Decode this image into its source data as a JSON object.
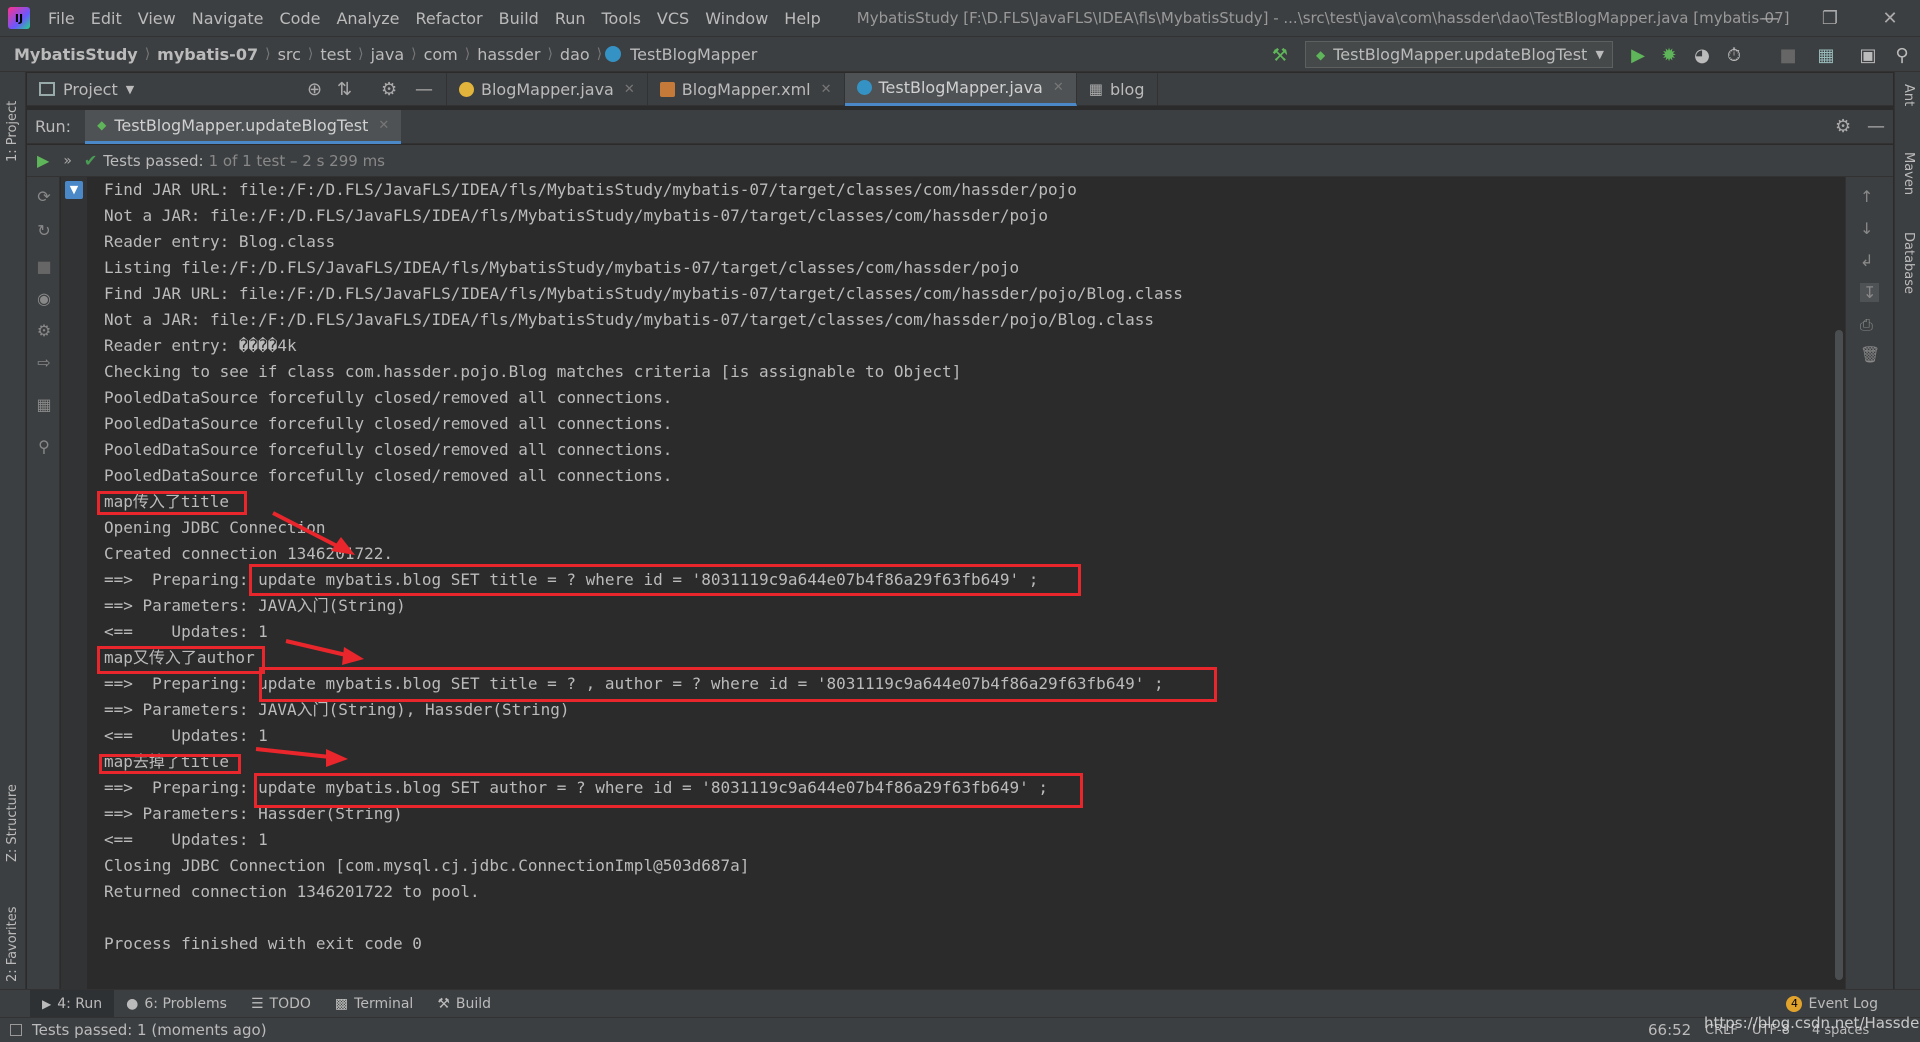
{
  "menubar": {
    "logo_text": "IJ",
    "items": [
      "File",
      "Edit",
      "View",
      "Navigate",
      "Code",
      "Analyze",
      "Refactor",
      "Build",
      "Run",
      "Tools",
      "VCS",
      "Window",
      "Help"
    ],
    "window_title": "MybatisStudy [F:\\D.FLS\\JavaFLS\\IDEA\\fls\\MybatisStudy] - ...\\src\\test\\java\\com\\hassder\\dao\\TestBlogMapper.java [mybatis-07]"
  },
  "breadcrumb": [
    "MybatisStudy",
    "mybatis-07",
    "src",
    "test",
    "java",
    "com",
    "hassder",
    "dao",
    "TestBlogMapper"
  ],
  "run_config": "TestBlogMapper.updateBlogTest",
  "project_pane": {
    "label": "Project"
  },
  "editor_tabs": [
    {
      "label": "BlogMapper.java",
      "color": "#e2b43c"
    },
    {
      "label": "BlogMapper.xml",
      "color": "#c57a3a"
    },
    {
      "label": "TestBlogMapper.java",
      "color": "#3592c4"
    },
    {
      "label": "blog",
      "color": "#999999"
    }
  ],
  "run_panel": {
    "label": "Run:",
    "tab_label": "TestBlogMapper.updateBlogTest",
    "tests_passed": "Tests passed:",
    "tests_count": "1 of 1 test – 2 s 299 ms"
  },
  "console_lines": [
    "Find JAR URL: file:/F:/D.FLS/JavaFLS/IDEA/fls/MybatisStudy/mybatis-07/target/classes/com/hassder/pojo",
    "Not a JAR: file:/F:/D.FLS/JavaFLS/IDEA/fls/MybatisStudy/mybatis-07/target/classes/com/hassder/pojo",
    "Reader entry: Blog.class",
    "Listing file:/F:/D.FLS/JavaFLS/IDEA/fls/MybatisStudy/mybatis-07/target/classes/com/hassder/pojo",
    "Find JAR URL: file:/F:/D.FLS/JavaFLS/IDEA/fls/MybatisStudy/mybatis-07/target/classes/com/hassder/pojo/Blog.class",
    "Not a JAR: file:/F:/D.FLS/JavaFLS/IDEA/fls/MybatisStudy/mybatis-07/target/classes/com/hassder/pojo/Blog.class",
    "Reader entry: ����4k",
    "Checking to see if class com.hassder.pojo.Blog matches criteria [is assignable to Object]",
    "PooledDataSource forcefully closed/removed all connections.",
    "PooledDataSource forcefully closed/removed all connections.",
    "PooledDataSource forcefully closed/removed all connections.",
    "PooledDataSource forcefully closed/removed all connections.",
    "map传入了title",
    "Opening JDBC Connection",
    "Created connection 1346201722.",
    "==>  Preparing: update mybatis.blog SET title = ? where id = '8031119c9a644e07b4f86a29f63fb649' ;",
    "==> Parameters: JAVA入门(String)",
    "<==    Updates: 1",
    "map又传入了author",
    "==>  Preparing: update mybatis.blog SET title = ? , author = ? where id = '8031119c9a644e07b4f86a29f63fb649' ;",
    "==> Parameters: JAVA入门(String), Hassder(String)",
    "<==    Updates: 1",
    "map去掉了title",
    "==>  Preparing: update mybatis.blog SET author = ? where id = '8031119c9a644e07b4f86a29f63fb649' ;",
    "==> Parameters: Hassder(String)",
    "<==    Updates: 1",
    "Closing JDBC Connection [com.mysql.cj.jdbc.ConnectionImpl@503d687a]",
    "Returned connection 1346201722 to pool.",
    "",
    "Process finished with exit code 0"
  ],
  "left_strip": {
    "project": "1: Project",
    "structure": "Z: Structure",
    "favorites": "2: Favorites"
  },
  "right_strip": {
    "ant": "Ant",
    "maven": "Maven",
    "database": "Database"
  },
  "bottom_tools": [
    {
      "label": "4: Run"
    },
    {
      "label": "6: Problems"
    },
    {
      "label": "TODO"
    },
    {
      "label": "Terminal"
    },
    {
      "label": "Build"
    }
  ],
  "event_log": {
    "badge": "4",
    "label": "Event Log"
  },
  "status_bar": {
    "message": "Tests passed: 1 (moments ago)",
    "position": "66:52",
    "line_sep": "CRLF",
    "encoding": "UTF-8",
    "indent": "4 spaces",
    "watermark": "https://blog.csdn.net/Hassder"
  },
  "colors": {
    "highlight": "#e8262b",
    "accent": "#4a88c7",
    "pass_green": "#499c54"
  }
}
